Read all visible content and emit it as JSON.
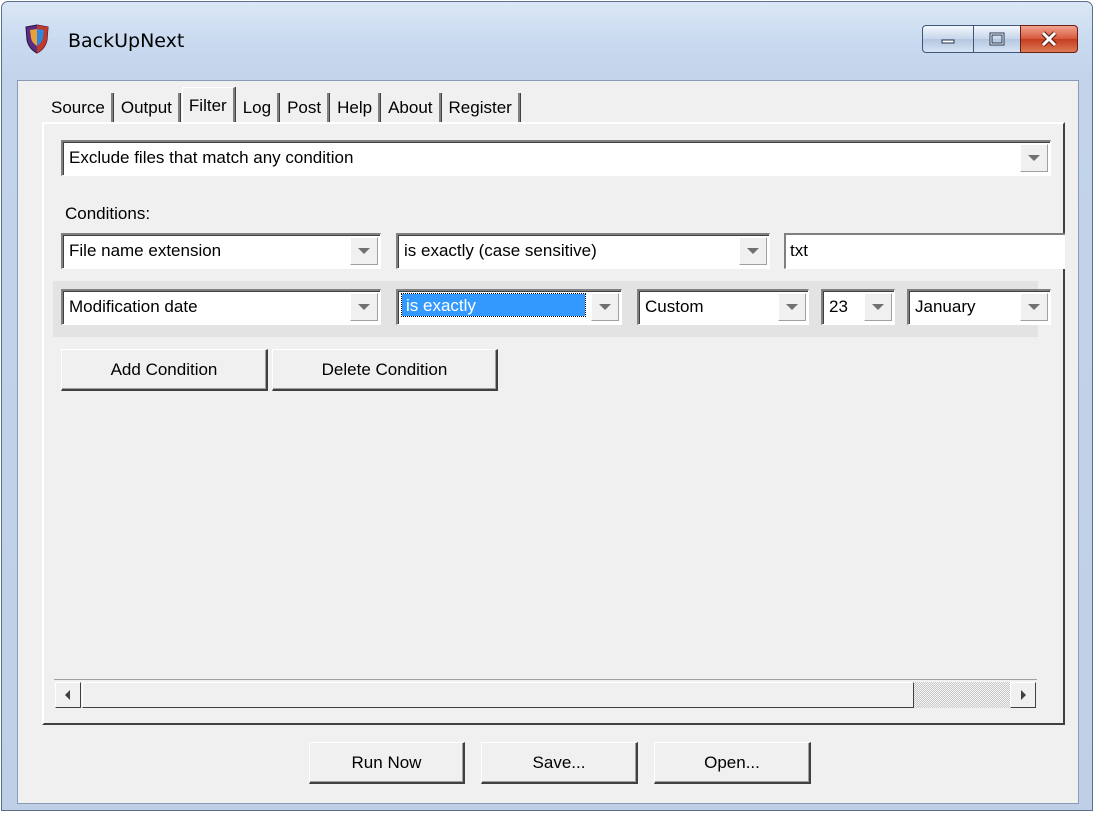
{
  "window": {
    "title": "BackUpNext",
    "app_icon": "shield-icon",
    "caption_buttons": [
      "minimize-icon",
      "maximize-icon",
      "close-icon"
    ]
  },
  "tabs": [
    {
      "label": "Source",
      "active": false
    },
    {
      "label": "Output",
      "active": false
    },
    {
      "label": "Filter",
      "active": true
    },
    {
      "label": "Log",
      "active": false
    },
    {
      "label": "Post",
      "active": false
    },
    {
      "label": "Help",
      "active": false
    },
    {
      "label": "About",
      "active": false
    },
    {
      "label": "Register",
      "active": false
    }
  ],
  "filter": {
    "mode_value": "Exclude files that match any condition",
    "conditions_label": "Conditions:",
    "condition1": {
      "field": "File name extension",
      "operator": "is exactly (case sensitive)",
      "value": "txt"
    },
    "condition2": {
      "field": "Modification date",
      "operator": "is exactly",
      "date_mode": "Custom",
      "day": "23",
      "month": "January"
    },
    "add_button": "Add Condition",
    "delete_button": "Delete Condition"
  },
  "footer": {
    "run_now": "Run Now",
    "save": "Save...",
    "open": "Open..."
  },
  "colors": {
    "selection": "#3399ff",
    "close_button": "#c33d1f",
    "titlebar": "#c9daf0"
  }
}
